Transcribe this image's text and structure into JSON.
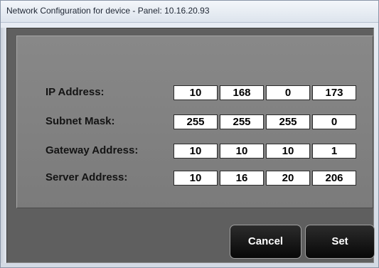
{
  "window": {
    "title": "Network Configuration for device - Panel: 10.16.20.93"
  },
  "fields": [
    {
      "label": "IP Address:",
      "octets": [
        "10",
        "168",
        "0",
        "173"
      ]
    },
    {
      "label": "Subnet Mask:",
      "octets": [
        "255",
        "255",
        "255",
        "0"
      ]
    },
    {
      "label": "Gateway Address:",
      "octets": [
        "10",
        "10",
        "10",
        "1"
      ]
    },
    {
      "label": "Server Address:",
      "octets": [
        "10",
        "16",
        "20",
        "206"
      ]
    }
  ],
  "buttons": {
    "cancel": "Cancel",
    "set": "Set"
  }
}
